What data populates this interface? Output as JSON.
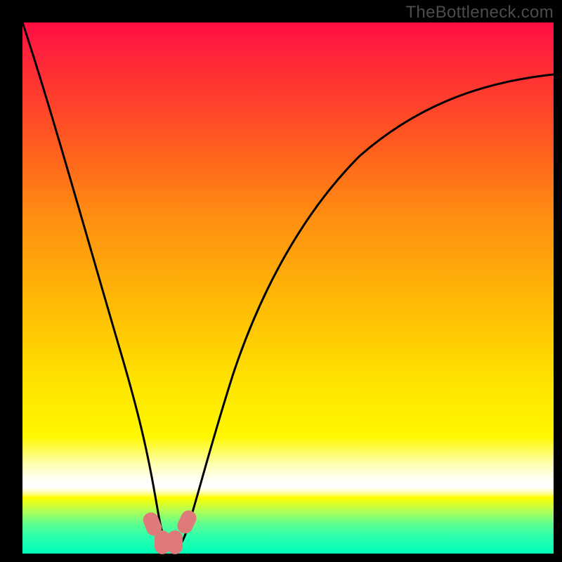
{
  "watermark": "TheBottleneck.com",
  "chart_data": {
    "type": "line",
    "title": "",
    "xlabel": "",
    "ylabel": "",
    "xlim": [
      0,
      100
    ],
    "ylim": [
      0,
      100
    ],
    "background_gradient": {
      "direction": "vertical",
      "description": "traffic-light gradient: red at top through orange, yellow, white band, to green at bottom; value height corresponds to bottleneck severity",
      "stops": [
        {
          "pos": 0,
          "color": "#ff0d42"
        },
        {
          "pos": 22,
          "color": "#ff5820"
        },
        {
          "pos": 55,
          "color": "#ffc004"
        },
        {
          "pos": 78,
          "color": "#fff800"
        },
        {
          "pos": 87,
          "color": "#ffffff"
        },
        {
          "pos": 100,
          "color": "#00ffb8"
        }
      ]
    },
    "series": [
      {
        "name": "bottleneck-curve",
        "color": "#000000",
        "x": [
          0,
          3,
          6,
          9,
          12,
          15,
          18,
          20,
          22,
          24,
          25.5,
          27,
          28.5,
          30,
          32,
          34,
          37,
          41,
          46,
          52,
          60,
          70,
          82,
          95,
          100
        ],
        "y": [
          100,
          88,
          76,
          64,
          52,
          41,
          30,
          22,
          14,
          7,
          3,
          1,
          1,
          3,
          9,
          17,
          28,
          40,
          51,
          60,
          69,
          76,
          82,
          87,
          89
        ]
      }
    ],
    "markers": [
      {
        "name": "min-region-left-edge",
        "x": 24.5,
        "y": 5.5
      },
      {
        "name": "min-region-left",
        "x": 26.2,
        "y": 2.0
      },
      {
        "name": "min-region-right",
        "x": 28.7,
        "y": 2.0
      },
      {
        "name": "min-region-right-edge",
        "x": 31.0,
        "y": 6.0
      }
    ],
    "annotations": []
  }
}
